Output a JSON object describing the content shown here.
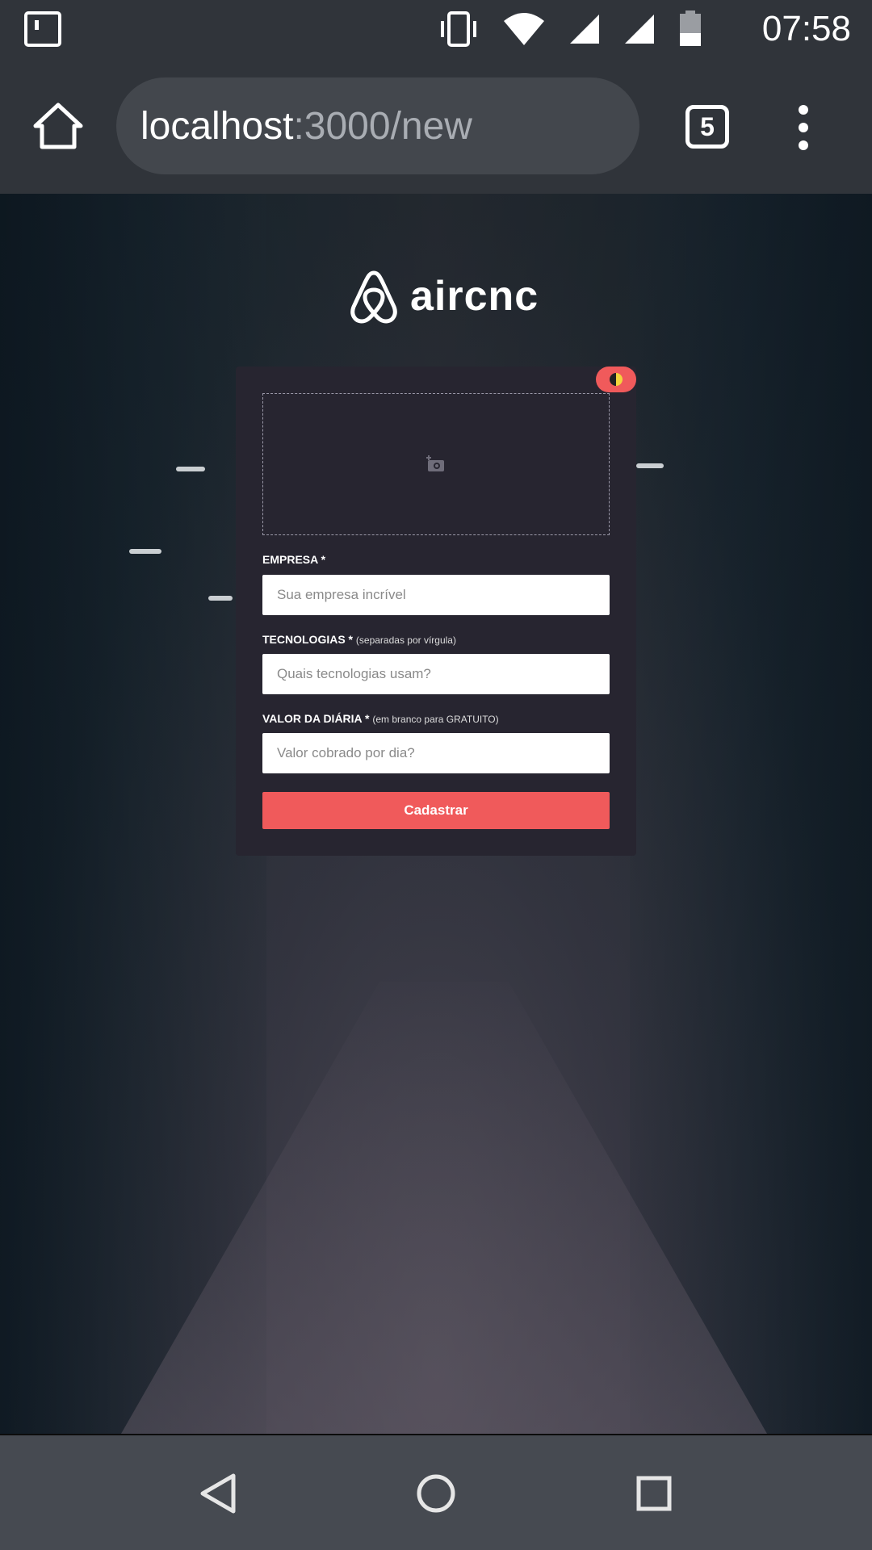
{
  "status_bar": {
    "time": "07:58",
    "icons": [
      "notification-icon",
      "vibrate-icon",
      "wifi-icon",
      "signal-icon",
      "signal-icon",
      "battery-icon"
    ]
  },
  "browser": {
    "url_host": "localhost",
    "url_rest": ":3000/new",
    "tab_count": "5"
  },
  "app": {
    "logo_text": "aircnc",
    "accent_color": "#f05a5b"
  },
  "form": {
    "company_label": "EMPRESA *",
    "company_placeholder": "Sua empresa incrível",
    "tech_label": "TECNOLOGIAS *",
    "tech_hint": "(separadas por vírgula)",
    "tech_placeholder": "Quais tecnologias usam?",
    "price_label": "VALOR DA DIÁRIA *",
    "price_hint": "(em branco para GRATUITO)",
    "price_placeholder": "Valor cobrado por dia?",
    "submit_label": "Cadastrar"
  },
  "nav": {
    "icons": [
      "back-icon",
      "home-circle-icon",
      "recents-icon"
    ]
  }
}
